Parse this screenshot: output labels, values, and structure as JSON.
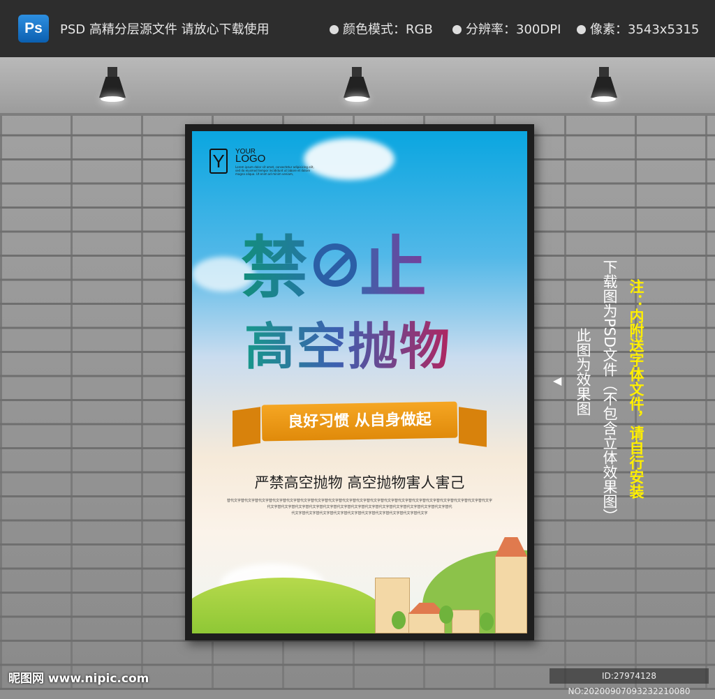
{
  "topbar": {
    "app_icon": "Ps",
    "title": "PSD 高精分层源文件 请放心下载使用",
    "specs": [
      "颜色模式：RGB",
      "分辨率：300DPI",
      "像素：3543x5315"
    ]
  },
  "poster": {
    "logo": {
      "mark": "Y",
      "your": "YOUR",
      "logo": "LOGO",
      "lorem": "Lorem ipsum dolor sit amet, consectetur adipisicing elit, sed do eiusmod tempor incididunt ut labore et dolore magna aliqua. Ut enim ad minim veniam,"
    },
    "title_a": "禁",
    "title_b": "止",
    "subtitle": "高空抛物",
    "ribbon": "良好习惯 从自身做起",
    "slogan": "严禁高空抛物 高空抛物害人害己",
    "filler": [
      "替代文字替代文字替代文字替代文字替代文字替代文字替代文字替代文字替代文字替代文字替代文字替代文字替代文字替代文字替代文字替代文字替代文字替代文字替代文字",
      "代文字替代文字替代文字替代文字替代文字替代文字替代文字替代文字替代文字替代文字替代文字替代文字替代文字替代",
      "代文字替代文字替代文字替代文字替代文字替代文字替代文字替代文字替代文字替代文字"
    ]
  },
  "side": {
    "effect": "此图为效果图",
    "psd": "下载图为PSD文件（不包含立体效果图）",
    "note": "注：内附送字体文件，请自行安装"
  },
  "footer": {
    "watermark": "昵图网 www.nipic.com",
    "id": "ID:27974128 NO:20200907093232210080"
  }
}
